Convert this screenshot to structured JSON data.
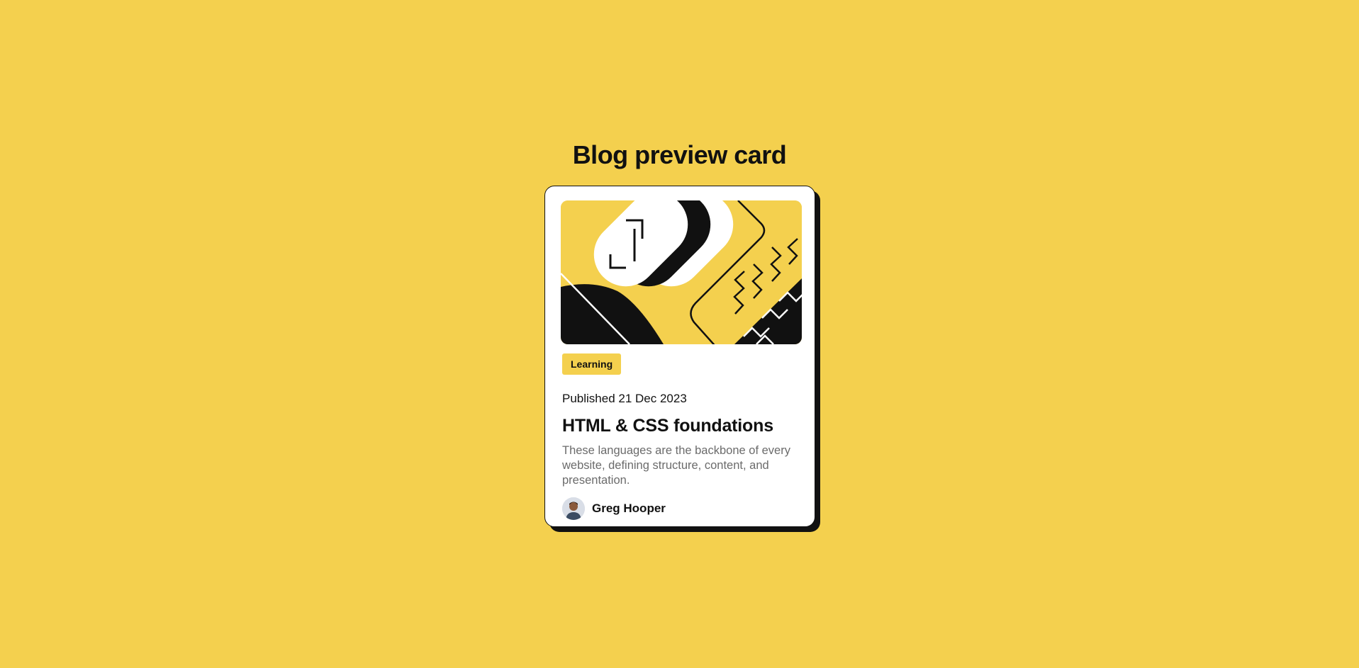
{
  "page": {
    "title": "Blog preview card"
  },
  "card": {
    "tag": "Learning",
    "published": "Published 21 Dec 2023",
    "title": "HTML & CSS foundations",
    "description": "These languages are the backbone of every website, defining structure, content, and presentation.",
    "author": {
      "name": "Greg Hooper"
    }
  },
  "colors": {
    "background": "#f4d04e",
    "card": "#ffffff",
    "ink": "#111111",
    "muted_text": "#6b6b6b"
  },
  "icons": {
    "illustration": "html-css-illustration",
    "avatar": "author-avatar"
  }
}
